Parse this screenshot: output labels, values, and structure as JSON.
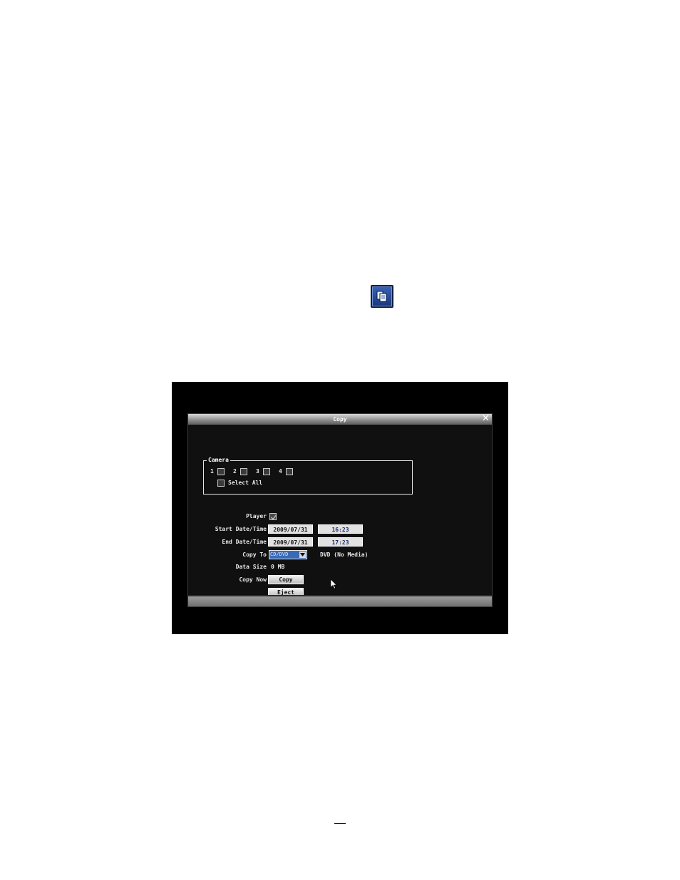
{
  "icons": {
    "toolbar_copy": "copy-icon",
    "close": "close-icon",
    "cursor": "cursor-icon",
    "dropdown": "chevron-down-icon"
  },
  "colors": {
    "dialog_bg": "#101010",
    "select_highlight": "#3a6ab4",
    "text": "#e8e8e8"
  },
  "dialog": {
    "title": "Copy",
    "camera_group": {
      "title": "Camera",
      "cameras": [
        {
          "label": "1",
          "checked": false
        },
        {
          "label": "2",
          "checked": false
        },
        {
          "label": "3",
          "checked": false
        },
        {
          "label": "4",
          "checked": false
        }
      ],
      "select_all_label": "Select All",
      "select_all_checked": false
    },
    "player": {
      "label": "Player",
      "checked": true
    },
    "start": {
      "label": "Start Date/Time",
      "date": "2009/07/31",
      "time": "16:23"
    },
    "end": {
      "label": "End Date/Time",
      "date": "2009/07/31",
      "time": "17:23"
    },
    "copy_to": {
      "label": "Copy To",
      "selected": "CD/DVD",
      "status": "DVD (No Media)"
    },
    "data_size": {
      "label": "Data Size",
      "value": "0 MB"
    },
    "copy_now": {
      "label": "Copy Now",
      "copy_button": "Copy",
      "eject_button": "Eject"
    }
  }
}
